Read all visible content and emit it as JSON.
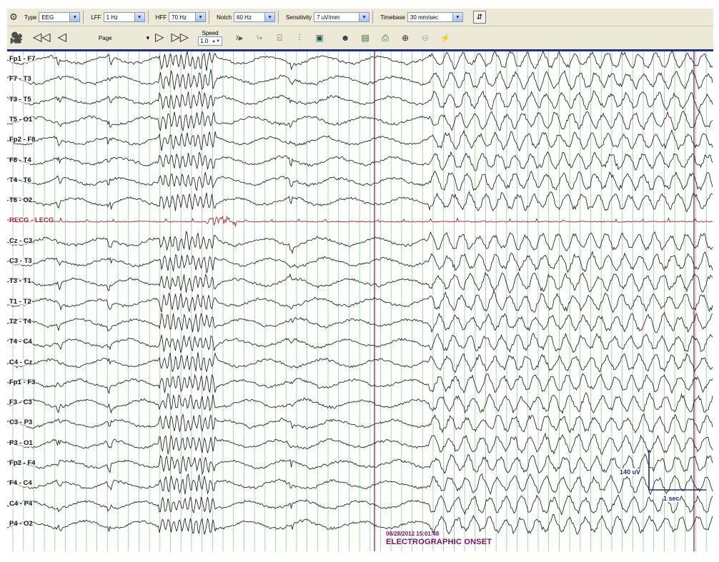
{
  "toolbar_top": {
    "type_label": "Type",
    "type_value": "EEG",
    "lff_label": "LFF",
    "lff_value": "1 Hz",
    "hff_label": "HFF",
    "hff_value": "70 Hz",
    "notch_label": "Notch",
    "notch_value": "60 Hz",
    "sensitivity_label": "Sensitivity",
    "sensitivity_value": "7 uV/mm",
    "timebase_label": "Timebase",
    "timebase_value": "30 mm/sec"
  },
  "toolbar_nav": {
    "page_label": "Page",
    "speed_label": "Speed",
    "speed_value": "1.0"
  },
  "channels": [
    {
      "label": "Fp1 - F7"
    },
    {
      "label": "F7 - T3"
    },
    {
      "label": "T3 - T5"
    },
    {
      "label": "T5 - O1"
    },
    {
      "label": "Fp2 - F8"
    },
    {
      "label": "F8 - T4"
    },
    {
      "label": "T4 - T6"
    },
    {
      "label": "T6 - O2"
    },
    {
      "label": "RECG - LECG",
      "ecg": true
    },
    {
      "label": "Cz - C3"
    },
    {
      "label": "C3 - T3"
    },
    {
      "label": "T3 - T1"
    },
    {
      "label": "T1 - T2"
    },
    {
      "label": "T2 - T4"
    },
    {
      "label": "T4 - C4"
    },
    {
      "label": "C4 - Cz"
    },
    {
      "label": "Fp1 - F3"
    },
    {
      "label": "F3 - C3"
    },
    {
      "label": "C3 - P3"
    },
    {
      "label": "P3 - O1"
    },
    {
      "label": "Fp2 - F4"
    },
    {
      "label": "F4 - C4"
    },
    {
      "label": "C4 - P4"
    },
    {
      "label": "P4 - O2"
    }
  ],
  "annotations": {
    "timestamp": "08/28/2012 15:01:48",
    "onset": "ELECTROGRAPHIC ONSET"
  },
  "calibration": {
    "amplitude": "140 uV",
    "time": "1 sec"
  },
  "colors": {
    "toolbar_bg": "#ece9d8",
    "grid_green": "#8fd18f",
    "trace": "#111111",
    "ecg_trace": "#b02030",
    "marker": "#7a1060",
    "calibration": "#1a2e8a"
  }
}
